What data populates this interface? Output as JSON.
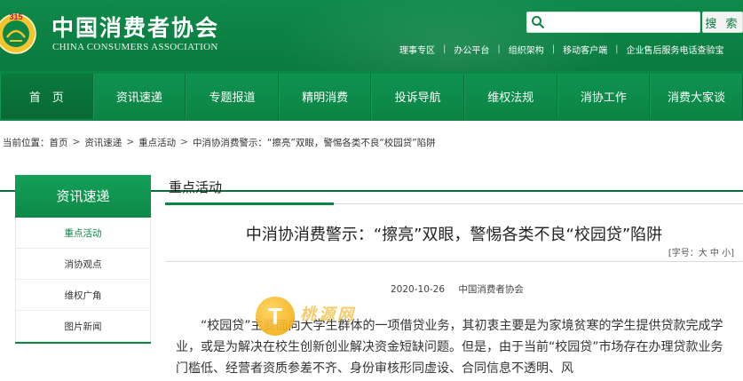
{
  "header": {
    "logo_cn": "中国消费者协会",
    "logo_en": "CHINA CONSUMERS ASSOCIATION",
    "emblem_label": "315"
  },
  "search": {
    "placeholder": "",
    "button_label": "搜 索"
  },
  "toplinks": [
    "理事专区",
    "办公平台",
    "组织架构",
    "移动客户端",
    "企业售后服务电话查验宝"
  ],
  "nav": {
    "items": [
      "首　页",
      "资讯速递",
      "专题报道",
      "精明消费",
      "投诉导航",
      "维权法规",
      "消协工作",
      "消费大家谈"
    ]
  },
  "breadcrumb": {
    "label": "当前位置：",
    "items": [
      "首页",
      "资讯速递",
      "重点活动",
      "中消协消费警示：“擦亮”双眼，警惕各类不良“校园贷”陷阱"
    ]
  },
  "sidebar": {
    "title": "资讯速递",
    "items": [
      "重点活动",
      "消协观点",
      "维权广角",
      "图片新闻"
    ]
  },
  "main": {
    "section_title": "重点活动"
  },
  "article": {
    "title": "中消协消费警示：“擦亮”双眼，警惕各类不良“校园贷”陷阱",
    "fontsize_label": "[字号：大 中 小]",
    "date": "2020-10-26",
    "author": "中国消费者协会",
    "body": "“校园贷”主要面向大学生群体的一项借贷业务，其初衷主要是为家境贫寒的学生提供贷款完成学业，或是为解决在校生创新创业解决资金短缺问题。但是，由于当前“校园贷”市场存在办理贷款业务门槛低、经营者资质参差不齐、身份审核形同虚设、合同信息不透明、风"
  },
  "watermark": {
    "icon_letter": "T",
    "text": "桃源网"
  },
  "colors": {
    "brand_green": "#0c8644",
    "header_green": "#0e8a4a",
    "accent_gold": "#f6b21c"
  }
}
